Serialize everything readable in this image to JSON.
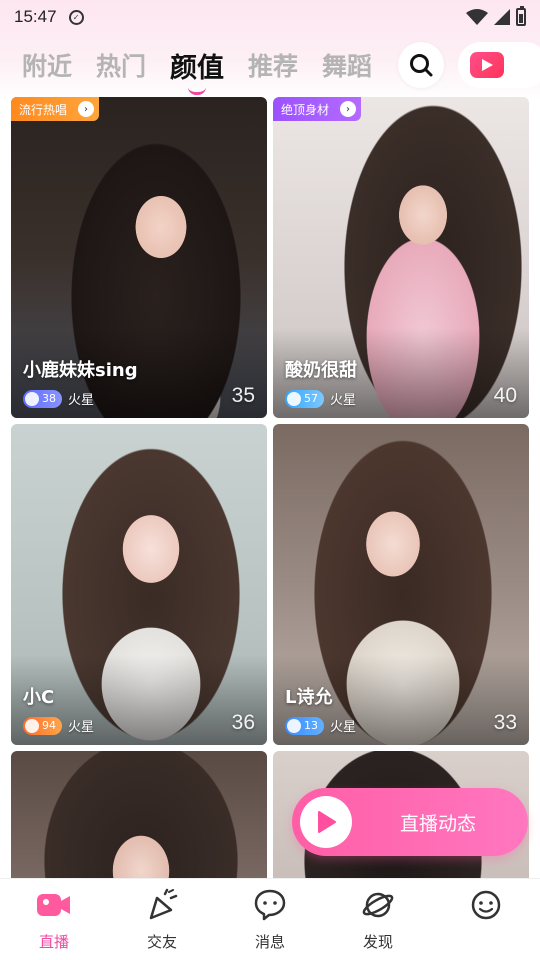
{
  "status_bar": {
    "time": "15:47"
  },
  "tabs": [
    {
      "label": "附近",
      "active": false
    },
    {
      "label": "热门",
      "active": false
    },
    {
      "label": "颜值",
      "active": true
    },
    {
      "label": "推荐",
      "active": false
    },
    {
      "label": "舞蹈",
      "active": false
    }
  ],
  "cards": [
    {
      "tag": "流行热唱",
      "tag_color": "#ff8a1f",
      "name": "小鹿妹妹sing",
      "level": "38",
      "location": "火星",
      "viewers": "35"
    },
    {
      "tag": "绝顶身材",
      "tag_color": "#9b52ff",
      "name": "酸奶很甜",
      "level": "57",
      "location": "火星",
      "viewers": "40"
    },
    {
      "tag": "",
      "name": "小C",
      "level": "94",
      "location": "火星",
      "viewers": "36"
    },
    {
      "tag": "",
      "name": "L诗允",
      "level": "13",
      "location": "火星",
      "viewers": "33"
    }
  ],
  "float_button": {
    "label": "直播动态"
  },
  "bottom_nav": [
    {
      "label": "直播",
      "icon": "live-camera-icon",
      "active": true
    },
    {
      "label": "交友",
      "icon": "party-popper-icon",
      "active": false
    },
    {
      "label": "消息",
      "icon": "chat-bubble-icon",
      "active": false
    },
    {
      "label": "发现",
      "icon": "planet-icon",
      "active": false
    },
    {
      "label": "",
      "icon": "smiley-icon",
      "active": false
    }
  ],
  "colors": {
    "accent": "#f04aa0",
    "live_red": "#ff3358"
  }
}
